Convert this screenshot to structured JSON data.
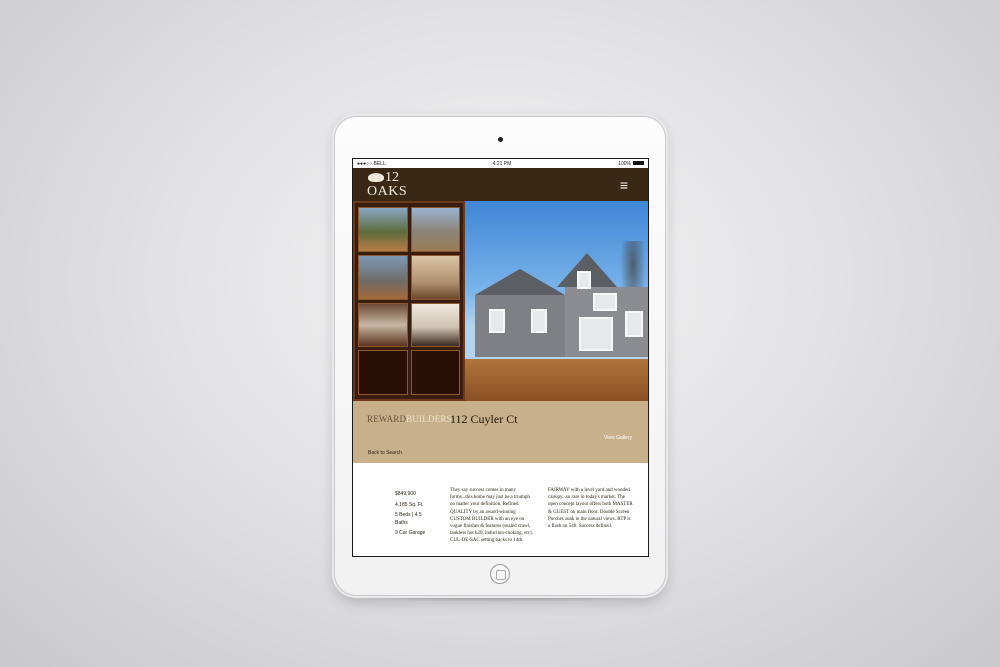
{
  "status_bar": {
    "carrier": "●●●○○ BELL",
    "time": "4:21 PM",
    "battery": "100%"
  },
  "nav": {
    "logo_number": "12",
    "logo_name": "OAKS",
    "menu_icon": "≡"
  },
  "listing": {
    "builder_part1": "REWARD",
    "builder_part2": "BUILDERS",
    "title": "112 Cuyler Ct",
    "view_gallery": "View Gallery",
    "back": "Back to Search"
  },
  "specs": {
    "price": "$849,900",
    "sqft": "4,185 Sq. Ft.",
    "beds_baths": "5 Beds | 4.5 Baths",
    "garage": "3 Car Garage"
  },
  "description": {
    "col1": "They say success comes in many forms...this home may just be a triumph no matter your definition. Refined QUALITY by an award-winning CUSTOM BUILDER with an eye on vogue finishes & features (sealed crawl, tankless hot h20, induction-cooking, etc). CUL-DE-SAC setting backs to 14th",
    "col2": "FAIRWAY with a level yard and wooded canopy...so rare in today's market. The open concept layout offers both MASTER & GUEST on main floor. Double Screen Porches soak in the natural views. RTP is a flash on 540. Success defined."
  }
}
